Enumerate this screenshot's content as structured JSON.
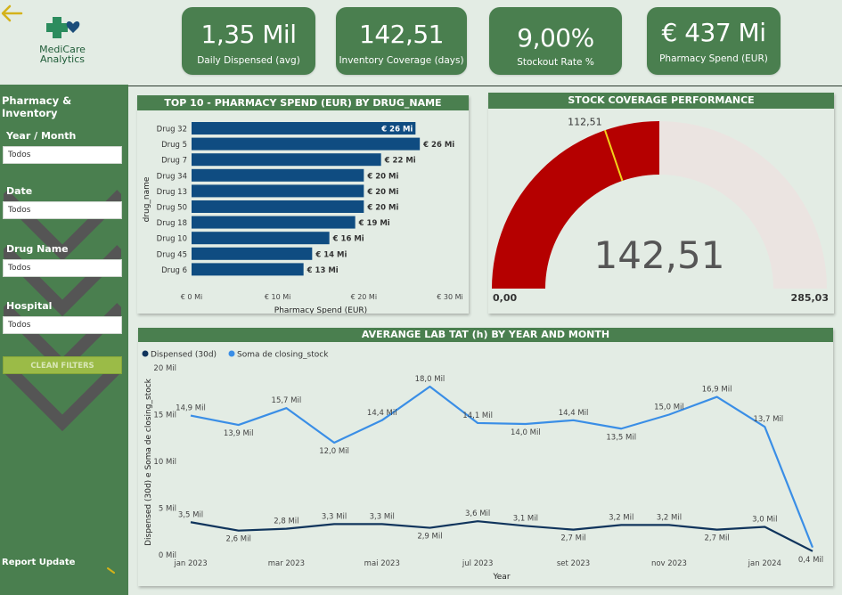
{
  "sidebar": {
    "logo_line1": "MediCare",
    "logo_line2": "Analytics",
    "filters_title": "Pharmacy & Inventory",
    "filters": [
      {
        "label": "Year / Month",
        "value": "Todos"
      },
      {
        "label": "Date",
        "value": "Todos"
      },
      {
        "label": "Drug Name",
        "value": "Todos"
      },
      {
        "label": "Hospital",
        "value": "Todos"
      }
    ],
    "clean_filters_label": "CLEAN FILTERS",
    "report_update_label": "Report Update"
  },
  "kpis": [
    {
      "value": "1,35 Mil",
      "label": "Daily Dispensed (avg)"
    },
    {
      "value": "142,51",
      "label": "Inventory Coverage (days)"
    },
    {
      "value": "9,00%",
      "label": "Stockout Rate %"
    },
    {
      "value": "€ 437 Mi",
      "label": "Pharmacy Spend (EUR)"
    }
  ],
  "colors": {
    "green": "#4a7f4f",
    "bar_blue": "#0f4c81",
    "gauge_red": "#b50000",
    "gauge_bg": "#ebe4e1",
    "line_light": "#3a8ee6",
    "line_dark": "#10345c",
    "button_lime": "#9bbb47"
  },
  "chart_data": [
    {
      "type": "bar",
      "title": "TOP 10 - PHARMACY SPEND (EUR) BY DRUG_NAME",
      "orientation": "horizontal",
      "categories": [
        "Drug 32",
        "Drug 5",
        "Drug 7",
        "Drug 34",
        "Drug 13",
        "Drug 50",
        "Drug 18",
        "Drug 10",
        "Drug 45",
        "Drug 6"
      ],
      "values": [
        26,
        26.5,
        22,
        20,
        20,
        20,
        19,
        16,
        14,
        13
      ],
      "data_labels": [
        "€ 26 Mi",
        "€ 26 Mi",
        "€ 22 Mi",
        "€ 20 Mi",
        "€ 20 Mi",
        "€ 20 Mi",
        "€ 19 Mi",
        "€ 16 Mi",
        "€ 14 Mi",
        "€ 13 Mi"
      ],
      "xlabel": "Pharmacy Spend (EUR)",
      "ylabel": "drug_name",
      "xlim": [
        0,
        30
      ],
      "xticks": [
        0,
        10,
        20,
        30
      ],
      "xtick_labels": [
        "€ 0 Mi",
        "€ 10 Mi",
        "€ 20 Mi",
        "€ 30 Mi"
      ]
    },
    {
      "type": "gauge",
      "title": "STOCK COVERAGE PERFORMANCE",
      "value": 142.51,
      "value_label": "142,51",
      "min": 0,
      "min_label": "0,00",
      "max": 285.03,
      "max_label": "285,03",
      "target": 112.51,
      "target_label": "112,51"
    },
    {
      "type": "line",
      "title": "AVERANGE LAB TAT (h) BY YEAR AND MONTH",
      "xlabel": "Year",
      "ylabel": "Dispensed (30d) e Soma de closing_stock",
      "x": [
        "2023-01",
        "2023-02",
        "2023-03",
        "2023-04",
        "2023-05",
        "2023-06",
        "2023-07",
        "2023-08",
        "2023-09",
        "2023-10",
        "2023-11",
        "2023-12",
        "2024-01",
        "2024-02"
      ],
      "xtick_labels": [
        "jan 2023",
        "mar 2023",
        "mai 2023",
        "jul 2023",
        "set 2023",
        "nov 2023",
        "jan 2024"
      ],
      "xtick_months": [
        "2023-01",
        "2023-03",
        "2023-05",
        "2023-07",
        "2023-09",
        "2023-11",
        "2024-01"
      ],
      "ylim": [
        0,
        20
      ],
      "yticks": [
        0,
        5,
        10,
        15,
        20
      ],
      "ytick_labels": [
        "0 Mil",
        "5 Mil",
        "10 Mil",
        "15 Mil",
        "20 Mil"
      ],
      "legend_position": "top-left",
      "series": [
        {
          "name": "Dispensed (30d)",
          "color": "#10345c",
          "values": [
            3.5,
            2.6,
            2.8,
            3.3,
            3.3,
            2.9,
            3.6,
            3.1,
            2.7,
            3.2,
            3.2,
            2.7,
            3.0,
            0.4
          ],
          "labels": [
            "3,5 Mil",
            "2,6 Mil",
            "2,8 Mil",
            "3,3 Mil",
            "3,3 Mil",
            "2,9 Mil",
            "3,6 Mil",
            "3,1 Mil",
            "2,7 Mil",
            "3,2 Mil",
            "3,2 Mil",
            "2,7 Mil",
            "3,0 Mil",
            "0,4 Mil"
          ]
        },
        {
          "name": "Soma de closing_stock",
          "color": "#3a8ee6",
          "values": [
            14.9,
            13.9,
            15.7,
            12.0,
            14.4,
            18.0,
            14.1,
            14.0,
            14.4,
            13.5,
            15.0,
            16.9,
            13.7,
            0.8
          ],
          "labels": [
            "14,9 Mil",
            "13,9 Mil",
            "15,7 Mil",
            "12,0 Mil",
            "14,4 Mil",
            "18,0 Mil",
            "14,1 Mil",
            "14,0 Mil",
            "14,4 Mil",
            "13,5 Mil",
            "15,0 Mil",
            "16,9 Mil",
            "13,7 Mil",
            ""
          ]
        }
      ]
    }
  ]
}
